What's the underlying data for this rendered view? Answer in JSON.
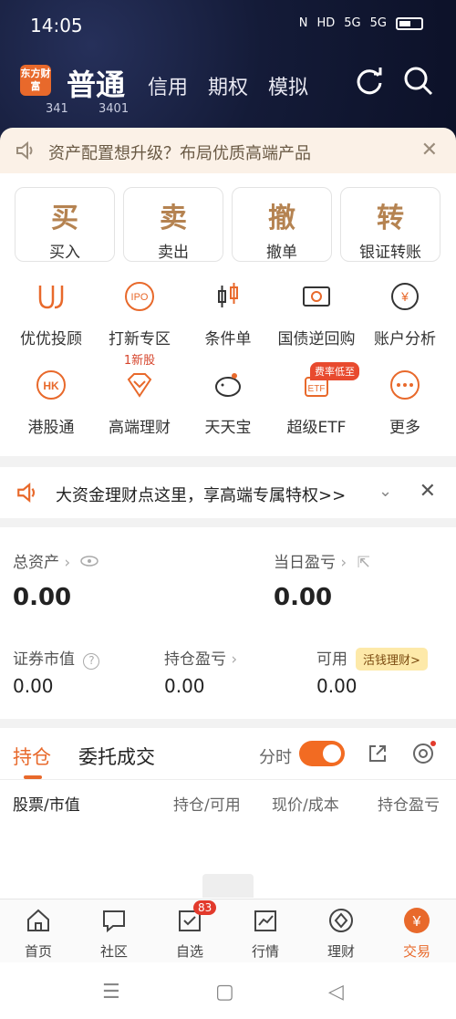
{
  "status_bar": {
    "time": "14:05",
    "indicators": [
      "N",
      "HD",
      "5G",
      "5G"
    ]
  },
  "header": {
    "logo_text": "东方财富",
    "tabs": [
      "普通",
      "信用",
      "期权",
      "模拟"
    ],
    "ticker_fragments": [
      "341",
      "3401"
    ]
  },
  "banner": {
    "text": "资产配置想升级？布局优质高端产品",
    "close": "✕"
  },
  "main_actions": [
    {
      "char": "买",
      "label": "买入"
    },
    {
      "char": "卖",
      "label": "卖出"
    },
    {
      "char": "撤",
      "label": "撤单"
    },
    {
      "char": "转",
      "label": "银证转账"
    }
  ],
  "features": [
    {
      "label": "优优投顾",
      "icon": "uu-advisor-icon"
    },
    {
      "label": "打新专区",
      "sub": "1新股",
      "icon": "ipo-icon"
    },
    {
      "label": "条件单",
      "icon": "candlestick-icon"
    },
    {
      "label": "国债逆回购",
      "icon": "repo-ticket-icon"
    },
    {
      "label": "账户分析",
      "icon": "yen-chart-icon"
    },
    {
      "label": "港股通",
      "icon": "hk-icon"
    },
    {
      "label": "高端理财",
      "icon": "diamond-icon"
    },
    {
      "label": "天天宝",
      "icon": "piggy-bank-icon"
    },
    {
      "label": "超级ETF",
      "badge": "费率低至",
      "icon": "etf-icon"
    },
    {
      "label": "更多",
      "icon": "more-icon"
    }
  ],
  "promo": {
    "text": "大资金理财点这里，享高端专属特权>>"
  },
  "assets": {
    "total_label": "总资产",
    "total_value": "0.00",
    "daily_label": "当日盈亏",
    "daily_value": "0.00",
    "market_label": "证券市值",
    "market_value": "0.00",
    "position_label": "持仓盈亏",
    "position_value": "0.00",
    "available_label": "可用",
    "available_value": "0.00",
    "pill": "活钱理财>"
  },
  "holdings": {
    "tab_active": "持仓",
    "tab_other": "委托成交",
    "fenshi": "分时",
    "columns": [
      "股票/市值",
      "持仓/可用",
      "现价/成本",
      "持仓盈亏"
    ]
  },
  "bottom_nav": [
    {
      "label": "首页"
    },
    {
      "label": "社区"
    },
    {
      "label": "自选",
      "badge": "83"
    },
    {
      "label": "行情"
    },
    {
      "label": "理财"
    },
    {
      "label": "交易"
    }
  ],
  "colors": {
    "accent": "#e8692b",
    "gold": "#b58351",
    "header_bg": "#141b38"
  }
}
